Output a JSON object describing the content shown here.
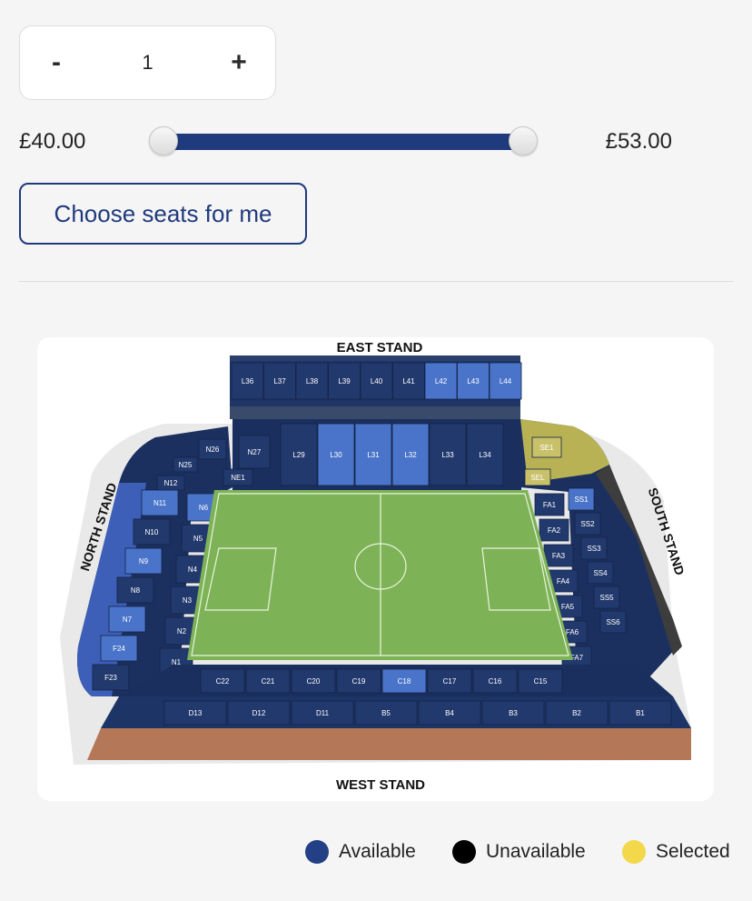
{
  "quantity": {
    "minus_label": "-",
    "value": "1",
    "plus_label": "+"
  },
  "price_range": {
    "min_label": "£40.00",
    "max_label": "£53.00",
    "fill_fraction": 1.0
  },
  "choose_button": {
    "label": "Choose seats for me"
  },
  "map": {
    "east_stand": "EAST STAND",
    "west_stand": "WEST STAND",
    "north_stand": "NORTH STAND",
    "south_stand": "SOUTH STAND",
    "east_upper": [
      "L36",
      "L37",
      "L38",
      "L39",
      "L40",
      "L41",
      "L42",
      "L43",
      "L44"
    ],
    "east_lower": [
      "L29",
      "L30",
      "L31",
      "L32",
      "L33",
      "L34"
    ],
    "west_upper": [
      "C22",
      "C21",
      "C20",
      "C19",
      "C18",
      "C17",
      "C16",
      "C15"
    ],
    "west_lower": [
      "D13",
      "D12",
      "D11",
      "B5",
      "B4",
      "B3",
      "B2",
      "B1"
    ],
    "north": [
      "N6",
      "N5",
      "N4",
      "N3",
      "N2",
      "N1"
    ],
    "north_outer": [
      "N11",
      "N10",
      "N9",
      "N8",
      "N7",
      "F24",
      "F23"
    ],
    "south": [
      "FA1",
      "FA2",
      "FA3",
      "FA4",
      "FA5",
      "FA6",
      "FA7"
    ],
    "south_outer": [
      "SS1",
      "SS2",
      "SS3",
      "SS4",
      "SS5",
      "SS6"
    ],
    "corner_labels": [
      "N26",
      "N27",
      "N25",
      "N12",
      "NE1",
      "SE1",
      "SEL"
    ]
  },
  "legend": [
    {
      "label": "Available",
      "color": "#233f86"
    },
    {
      "label": "Unavailable",
      "color": "#000000"
    },
    {
      "label": "Selected",
      "color": "#f2d84a"
    }
  ]
}
